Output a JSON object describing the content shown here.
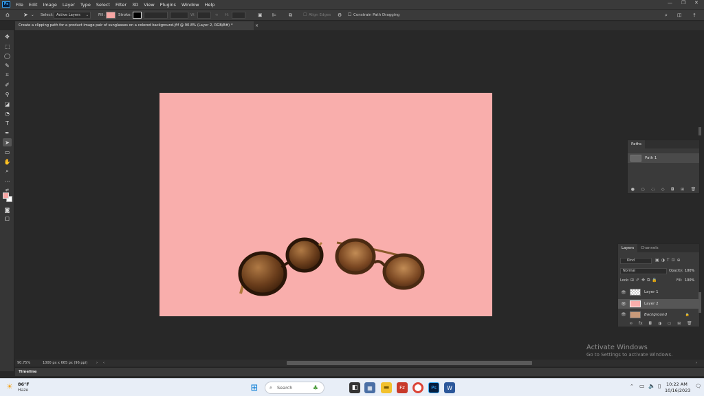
{
  "app": {
    "logo": "Ps"
  },
  "menu": [
    "File",
    "Edit",
    "Image",
    "Layer",
    "Type",
    "Select",
    "Filter",
    "3D",
    "View",
    "Plugins",
    "Window",
    "Help"
  ],
  "window_controls": {
    "minimize": "—",
    "restore": "❐",
    "close": "✕"
  },
  "options": {
    "select_label": "Select:",
    "select_value": "Active Layers",
    "fill_label": "Fill:",
    "fill_color": "#f7a6a4",
    "stroke_label": "Stroke:",
    "w_label": "W:",
    "h_label": "H:",
    "align_edges": "Align Edges",
    "constrain": "Constrain Path Dragging"
  },
  "document": {
    "tab_title": "Create a clipping path for a product image pair of sunglasses on a colored background.jfif @ 90.8% (Layer 2, RGB/8#) *",
    "close": "×",
    "canvas_color": "#f9aeac"
  },
  "paths_panel": {
    "tab": "Paths",
    "items": [
      {
        "name": "Path 1"
      }
    ]
  },
  "layers_panel": {
    "tabs": [
      "Layers",
      "Channels"
    ],
    "filter": "Kind",
    "blend_mode": "Normal",
    "opacity_label": "Opacity:",
    "opacity_value": "100%",
    "lock_label": "Lock:",
    "fill_label": "Fill:",
    "fill_value": "100%",
    "layers": [
      {
        "name": "Layer 1",
        "selected": false
      },
      {
        "name": "Layer 2",
        "selected": true
      },
      {
        "name": "Background",
        "selected": false
      }
    ]
  },
  "status": {
    "zoom": "90.75%",
    "doc_info": "1000 px x 665 px (96 ppi)"
  },
  "timeline": {
    "label": "Timeline"
  },
  "watermark": {
    "title": "Activate Windows",
    "subtitle": "Go to Settings to activate Windows."
  },
  "taskbar": {
    "weather_temp": "86°F",
    "weather_desc": "Haze",
    "search_placeholder": "Search",
    "time": "10:22 AM",
    "date": "10/16/2023"
  }
}
